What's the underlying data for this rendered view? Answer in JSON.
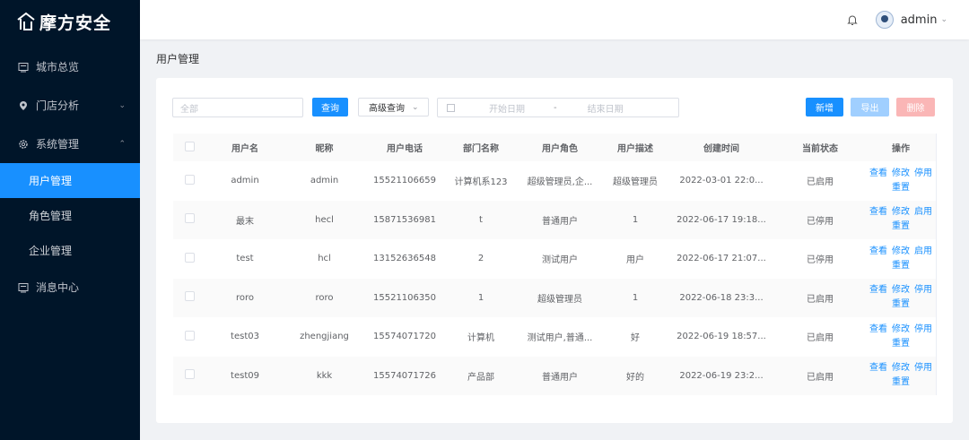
{
  "brand": {
    "name": "摩方安全"
  },
  "sidebar": {
    "items": [
      {
        "label": "城市总览",
        "icon": "monitor-icon"
      },
      {
        "label": "门店分析",
        "icon": "location-icon",
        "expandable": true
      },
      {
        "label": "系统管理",
        "icon": "gear-icon",
        "expanded": true
      },
      {
        "label": "消息中心",
        "icon": "message-icon"
      }
    ],
    "sub_items": [
      {
        "label": "用户管理",
        "active": true
      },
      {
        "label": "角色管理"
      },
      {
        "label": "企业管理"
      }
    ]
  },
  "header": {
    "user": "admin"
  },
  "breadcrumb": "用户管理",
  "toolbar": {
    "search_placeholder": "全部",
    "query_label": "查询",
    "advanced_label": "高级查询",
    "start_date_placeholder": "开始日期",
    "date_separator": "-",
    "end_date_placeholder": "结束日期",
    "add_label": "新增",
    "export_label": "导出",
    "delete_label": "删除"
  },
  "table": {
    "columns": [
      "用户名",
      "昵称",
      "用户电话",
      "部门名称",
      "用户角色",
      "用户描述",
      "创建时间",
      "当前状态",
      "操作"
    ],
    "rows": [
      {
        "username": "admin",
        "nickname": "admin",
        "phone": "15521106659",
        "dept": "计算机系123",
        "role": "超级管理员,企...",
        "desc": "超级管理员",
        "created": "2022-03-01 22:0...",
        "status": "已启用",
        "op1": "查看",
        "op2": "修改",
        "op3": "停用",
        "op4": "重置"
      },
      {
        "username": "最末",
        "nickname": "hecl",
        "phone": "15871536981",
        "dept": "t",
        "role": "普通用户",
        "desc": "1",
        "created": "2022-06-17 19:18...",
        "status": "已停用",
        "op1": "查看",
        "op2": "修改",
        "op3": "启用",
        "op4": "重置"
      },
      {
        "username": "test",
        "nickname": "hcl",
        "phone": "13152636548",
        "dept": "2",
        "role": "测试用户",
        "desc": "用户",
        "created": "2022-06-17 21:07...",
        "status": "已停用",
        "op1": "查看",
        "op2": "修改",
        "op3": "启用",
        "op4": "重置"
      },
      {
        "username": "roro",
        "nickname": "roro",
        "phone": "15521106350",
        "dept": "1",
        "role": "超级管理员",
        "desc": "1",
        "created": "2022-06-18 23:3...",
        "status": "已启用",
        "op1": "查看",
        "op2": "修改",
        "op3": "停用",
        "op4": "重置"
      },
      {
        "username": "test03",
        "nickname": "zhengjiang",
        "phone": "15574071720",
        "dept": "计算机",
        "role": "测试用户,普通...",
        "desc": "好",
        "created": "2022-06-19 18:57...",
        "status": "已启用",
        "op1": "查看",
        "op2": "修改",
        "op3": "停用",
        "op4": "重置"
      },
      {
        "username": "test09",
        "nickname": "kkk",
        "phone": "15574071726",
        "dept": "产品部",
        "role": "普通用户",
        "desc": "好的",
        "created": "2022-06-19 23:2...",
        "status": "已启用",
        "op1": "查看",
        "op2": "修改",
        "op3": "停用",
        "op4": "重置"
      }
    ]
  },
  "colors": {
    "sidebar_bg": "#001529",
    "primary": "#1890ff",
    "export_disabled": "#a0cfff",
    "delete_disabled": "#fab6b6"
  }
}
